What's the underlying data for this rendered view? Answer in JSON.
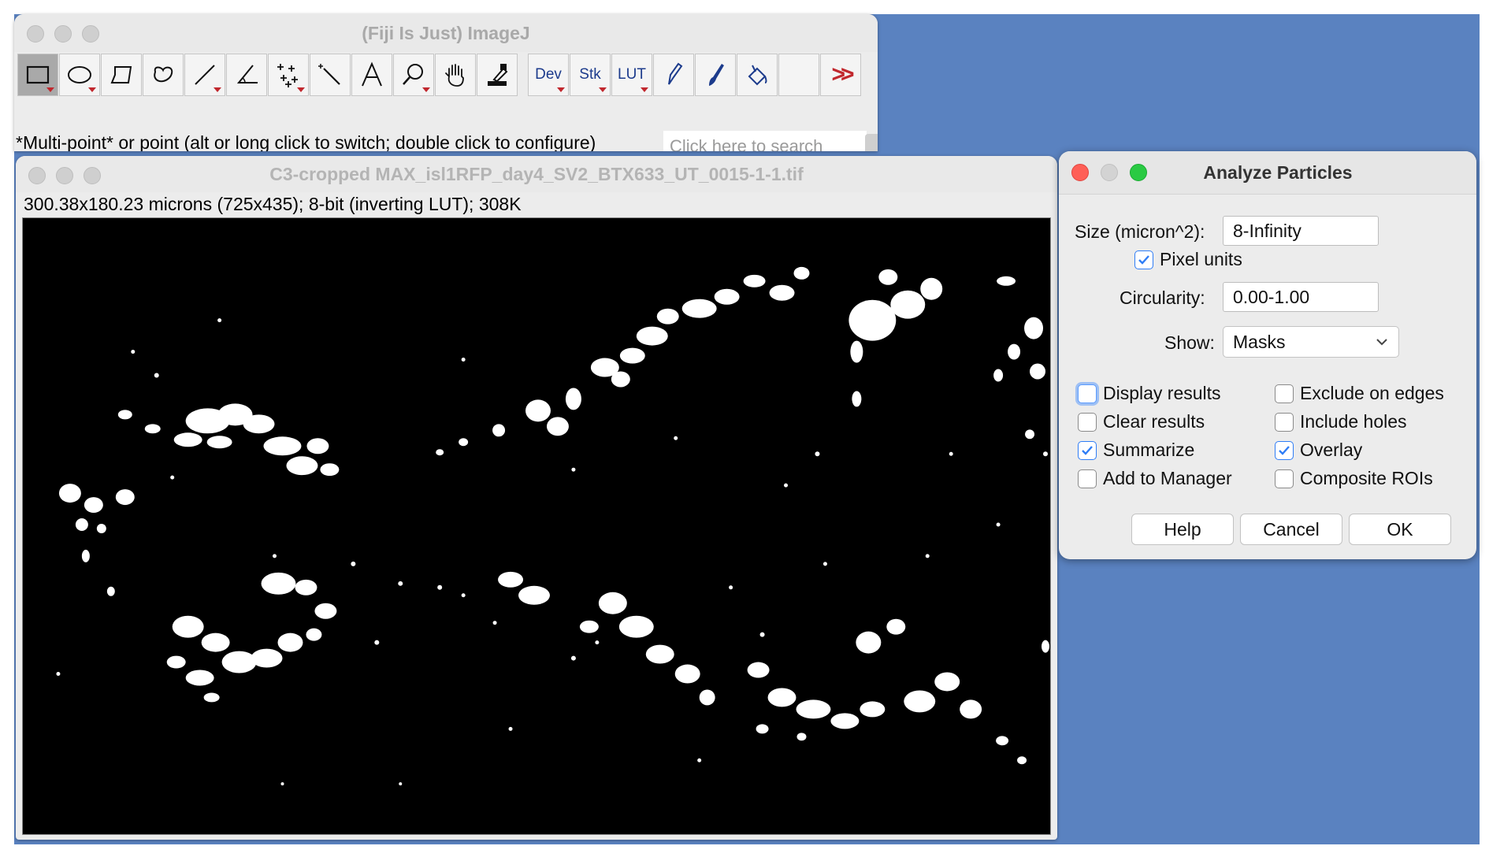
{
  "toolbar_window": {
    "title": "(Fiji Is Just) ImageJ",
    "tools": [
      {
        "name": "rectangle-tool",
        "icon": "rectangle-icon",
        "has_menu": true,
        "selected": true
      },
      {
        "name": "oval-tool",
        "icon": "oval-icon",
        "has_menu": true
      },
      {
        "name": "polygon-tool",
        "icon": "polygon-icon"
      },
      {
        "name": "freehand-tool",
        "icon": "freehand-icon"
      },
      {
        "name": "line-tool",
        "icon": "line-icon",
        "has_menu": true
      },
      {
        "name": "angle-tool",
        "icon": "angle-icon"
      },
      {
        "name": "multipoint-tool",
        "icon": "multipoint-icon",
        "has_menu": true
      },
      {
        "name": "wand-tool",
        "icon": "wand-icon"
      },
      {
        "name": "text-tool",
        "icon": "text-icon"
      },
      {
        "name": "zoom-tool",
        "icon": "magnifier-icon",
        "has_menu": true
      },
      {
        "name": "hand-tool",
        "icon": "hand-icon"
      },
      {
        "name": "color-picker-tool",
        "icon": "dropper-icon"
      }
    ],
    "menu_tools": [
      {
        "label": "Dev"
      },
      {
        "label": "Stk"
      },
      {
        "label": "LUT"
      }
    ],
    "status": "*Multi-point* or point (alt or long click to switch; double click to configure)",
    "search_placeholder": "Click here to search"
  },
  "image_window": {
    "title": "C3-cropped MAX_isl1RFP_day4_SV2_BTX633_UT_0015-1-1.tif",
    "info": "300.38x180.23 microns (725x435); 8-bit (inverting LUT); 308K"
  },
  "dialog": {
    "title": "Analyze Particles",
    "size_label": "Size (micron^2):",
    "size_value": "8-Infinity",
    "pixel_units_label": "Pixel units",
    "pixel_units": true,
    "circularity_label": "Circularity:",
    "circularity_value": "0.00-1.00",
    "show_label": "Show:",
    "show_value": "Masks",
    "options": {
      "display_results": {
        "label": "Display results",
        "checked": false
      },
      "exclude_on_edges": {
        "label": "Exclude on edges",
        "checked": false
      },
      "clear_results": {
        "label": "Clear results",
        "checked": false
      },
      "include_holes": {
        "label": "Include holes",
        "checked": false
      },
      "summarize": {
        "label": "Summarize",
        "checked": true
      },
      "overlay": {
        "label": "Overlay",
        "checked": true
      },
      "add_to_manager": {
        "label": "Add to Manager",
        "checked": false
      },
      "composite_rois": {
        "label": "Composite ROIs",
        "checked": false
      }
    },
    "buttons": {
      "help": "Help",
      "cancel": "Cancel",
      "ok": "OK"
    }
  }
}
